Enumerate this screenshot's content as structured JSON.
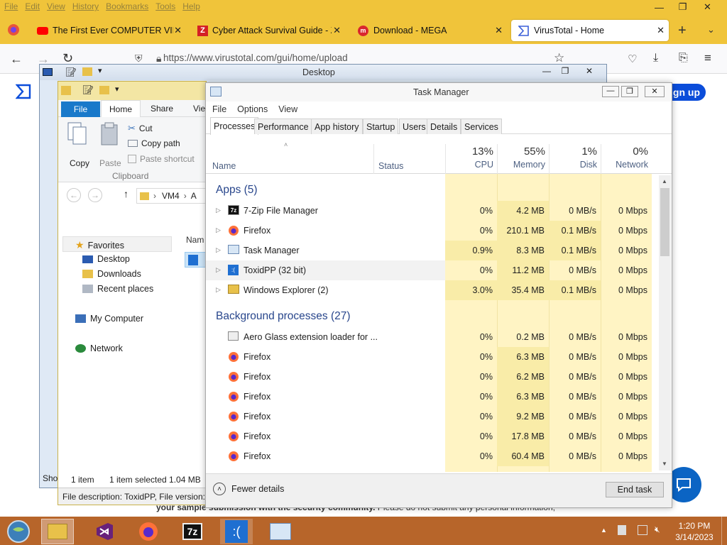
{
  "firefox": {
    "menu": [
      "File",
      "Edit",
      "View",
      "History",
      "Bookmarks",
      "Tools",
      "Help"
    ],
    "tabs": [
      {
        "title": "The First Ever COMPUTER VIRU"
      },
      {
        "title": "Cyber Attack Survival Guide - Z"
      },
      {
        "title": "Download - MEGA"
      },
      {
        "title": "VirusTotal - Home"
      }
    ],
    "url": "https://www.virustotal.com/gui/home/upload",
    "sign_up": "Sign up",
    "page_footer_bold": "your sample submission with the security community.",
    "page_footer_rest": " Please do not submit any personal information,"
  },
  "desktop_window": {
    "title": "Desktop"
  },
  "explorer": {
    "ribbon_tabs": [
      "File",
      "Home",
      "Share",
      "View"
    ],
    "copy": "Copy",
    "paste": "Paste",
    "cut": "Cut",
    "copy_path": "Copy path",
    "paste_shortcut": "Paste shortcut",
    "group_clipboard": "Clipboard",
    "breadcrumb": [
      "VM4",
      "A"
    ],
    "col_name": "Nam",
    "nav": {
      "favorites": "Favorites",
      "desktop": "Desktop",
      "downloads": "Downloads",
      "recent": "Recent places",
      "computer": "My Computer",
      "network": "Network"
    },
    "status_items": "1 item",
    "status_selected": "1 item selected  1.04 MB",
    "file_desc": "File description: ToxidPP, File version:",
    "left_clip": "Sho"
  },
  "taskmgr": {
    "title": "Task Manager",
    "menu": [
      "File",
      "Options",
      "View"
    ],
    "tabs": [
      "Processes",
      "Performance",
      "App history",
      "Startup",
      "Users",
      "Details",
      "Services"
    ],
    "cols": {
      "name": "Name",
      "status": "Status",
      "cpu_pct": "13%",
      "cpu": "CPU",
      "mem_pct": "55%",
      "mem": "Memory",
      "disk_pct": "1%",
      "disk": "Disk",
      "net_pct": "0%",
      "net": "Network"
    },
    "apps_header": "Apps (5)",
    "apps": [
      {
        "name": "7-Zip File Manager",
        "cpu": "0%",
        "mem": "4.2 MB",
        "disk": "0 MB/s",
        "net": "0 Mbps",
        "icon": "7zip-icon"
      },
      {
        "name": "Firefox",
        "cpu": "0%",
        "mem": "210.1 MB",
        "disk": "0.1 MB/s",
        "net": "0 Mbps",
        "icon": "firefox-icon"
      },
      {
        "name": "Task Manager",
        "cpu": "0.9%",
        "mem": "8.3 MB",
        "disk": "0.1 MB/s",
        "net": "0 Mbps",
        "icon": "taskmgr-icon"
      },
      {
        "name": "ToxidPP (32 bit)",
        "cpu": "0%",
        "mem": "11.2 MB",
        "disk": "0 MB/s",
        "net": "0 Mbps",
        "icon": "toxidpp-icon"
      },
      {
        "name": "Windows Explorer (2)",
        "cpu": "3.0%",
        "mem": "35.4 MB",
        "disk": "0.1 MB/s",
        "net": "0 Mbps",
        "icon": "explorer-icon"
      }
    ],
    "bg_header": "Background processes (27)",
    "background": [
      {
        "name": "Aero Glass extension loader for ...",
        "cpu": "0%",
        "mem": "0.2 MB",
        "disk": "0 MB/s",
        "net": "0 Mbps",
        "icon": "generic-app-icon"
      },
      {
        "name": "Firefox",
        "cpu": "0%",
        "mem": "6.3 MB",
        "disk": "0 MB/s",
        "net": "0 Mbps",
        "icon": "firefox-icon"
      },
      {
        "name": "Firefox",
        "cpu": "0%",
        "mem": "6.2 MB",
        "disk": "0 MB/s",
        "net": "0 Mbps",
        "icon": "firefox-icon"
      },
      {
        "name": "Firefox",
        "cpu": "0%",
        "mem": "6.3 MB",
        "disk": "0 MB/s",
        "net": "0 Mbps",
        "icon": "firefox-icon"
      },
      {
        "name": "Firefox",
        "cpu": "0%",
        "mem": "9.2 MB",
        "disk": "0 MB/s",
        "net": "0 Mbps",
        "icon": "firefox-icon"
      },
      {
        "name": "Firefox",
        "cpu": "0%",
        "mem": "17.8 MB",
        "disk": "0 MB/s",
        "net": "0 Mbps",
        "icon": "firefox-icon"
      },
      {
        "name": "Firefox",
        "cpu": "0%",
        "mem": "60.4 MB",
        "disk": "0 MB/s",
        "net": "0 Mbps",
        "icon": "firefox-icon"
      }
    ],
    "fewer_details": "Fewer details",
    "end_task": "End task"
  },
  "taskbar": {
    "time": "1:20 PM",
    "date": "3/14/2023"
  },
  "colors": {
    "firefox_bar": "#f0c43a",
    "taskbar": "#b7652a",
    "heat_light": "#fff4c4",
    "heat_mid": "#f9eca8",
    "group_text": "#28468c",
    "virustotal_blue": "#0b4dda"
  }
}
